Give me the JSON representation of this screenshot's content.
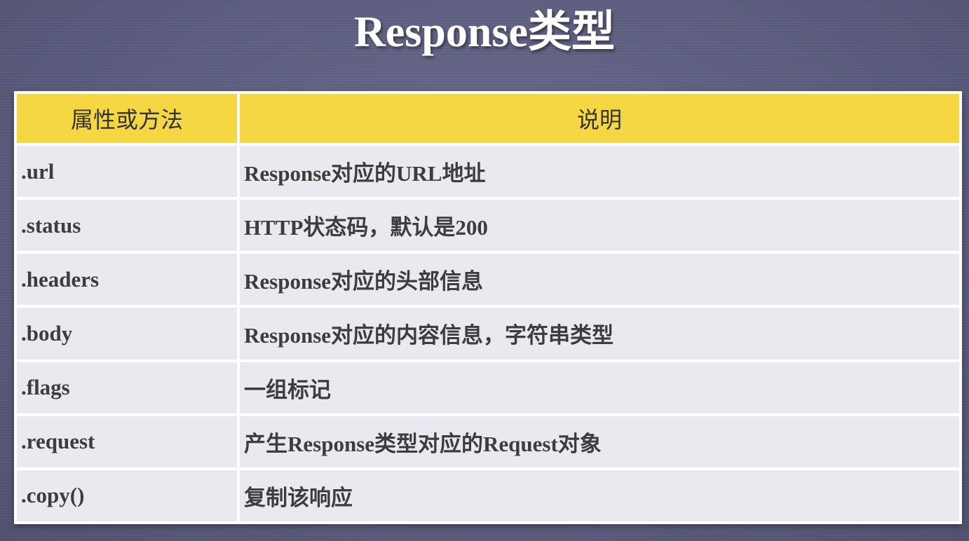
{
  "slide": {
    "title": "Response类型"
  },
  "table": {
    "headers": [
      "属性或方法",
      "说明"
    ],
    "rows": [
      {
        "name": ".url",
        "description": "Response对应的URL地址"
      },
      {
        "name": ".status",
        "description": "HTTP状态码，默认是200"
      },
      {
        "name": ".headers",
        "description": "Response对应的头部信息"
      },
      {
        "name": ".body",
        "description": "Response对应的内容信息，字符串类型"
      },
      {
        "name": ".flags",
        "description": "一组标记"
      },
      {
        "name": ".request",
        "description": "产生Response类型对应的Request对象"
      },
      {
        "name": ".copy()",
        "description": "复制该响应"
      }
    ]
  },
  "colors": {
    "background": "#5d5e80",
    "header_fill": "#f5d744",
    "cell_fill": "#e9e9ef",
    "title_text": "#ffffff"
  }
}
